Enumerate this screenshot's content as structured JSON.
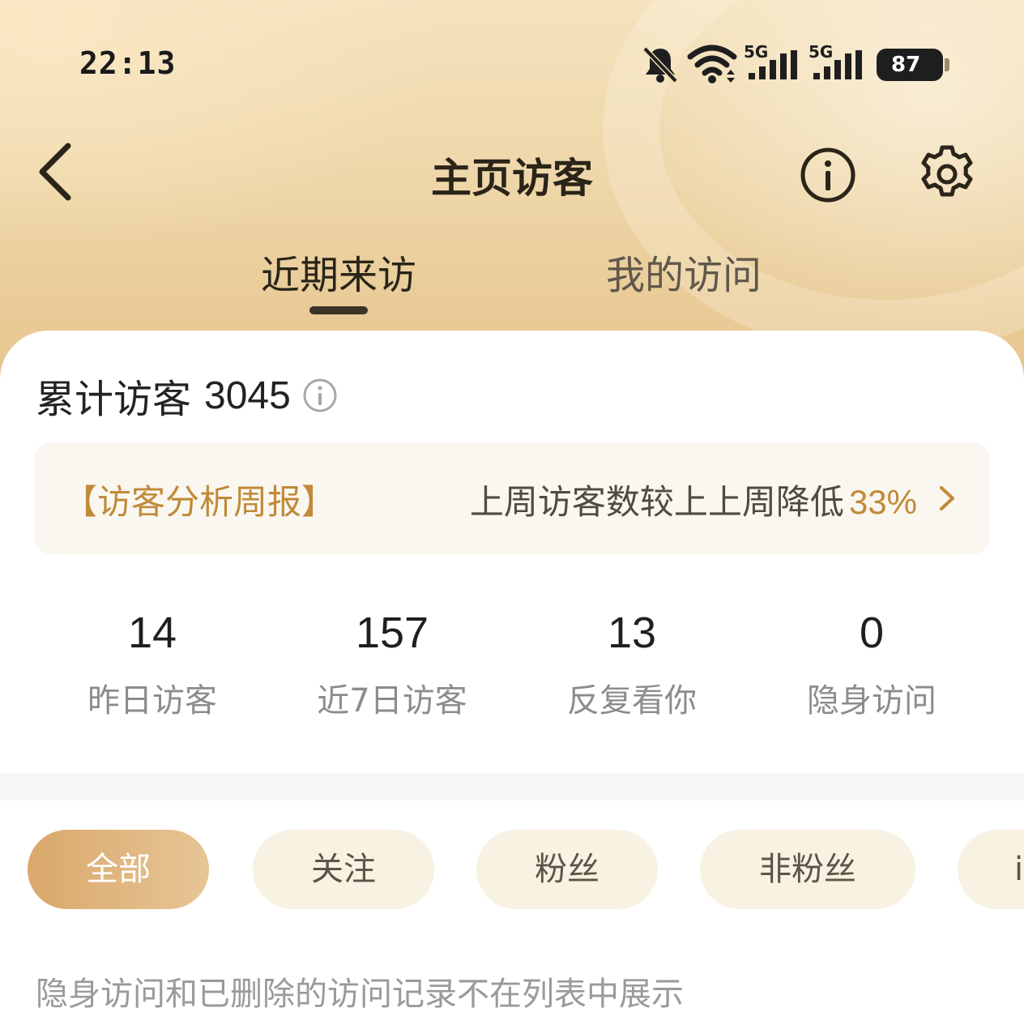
{
  "status_bar": {
    "time": "22:13",
    "battery": "87",
    "icons": [
      "bell-muted-icon",
      "wifi-icon",
      "signal-5g-icon",
      "signal-5g-icon",
      "battery-icon"
    ],
    "network_label_1": "5G",
    "network_label_2": "5G"
  },
  "header": {
    "title": "主页访客",
    "back_icon": "chevron-left-icon",
    "info_icon": "info-icon",
    "settings_icon": "gear-icon"
  },
  "tabs": [
    {
      "label": "近期来访",
      "active": true
    },
    {
      "label": "我的访问",
      "active": false
    }
  ],
  "summary": {
    "total_label": "累计访客",
    "total_value": "3045"
  },
  "report": {
    "tag": "【访客分析周报】",
    "text": "上周访客数较上上周降低",
    "percent": "33%"
  },
  "stats": [
    {
      "value": "14",
      "label": "昨日访客"
    },
    {
      "value": "157",
      "label": "近7日访客"
    },
    {
      "value": "13",
      "label": "反复看你"
    },
    {
      "value": "0",
      "label": "隐身访问"
    }
  ],
  "filters": [
    {
      "label": "全部",
      "selected": true
    },
    {
      "label": "关注",
      "selected": false
    },
    {
      "label": "粉丝",
      "selected": false
    },
    {
      "label": "非粉丝",
      "selected": false
    },
    {
      "label": "i",
      "selected": false
    }
  ],
  "notice": "隐身访问和已删除的访问记录不在列表中展示",
  "colors": {
    "accent": "#c08a38",
    "chip_selected_start": "#d9a86b",
    "chip_selected_end": "#e7c596",
    "chip_bg": "#f8f2e3",
    "header_gold": "#edd4a5"
  }
}
